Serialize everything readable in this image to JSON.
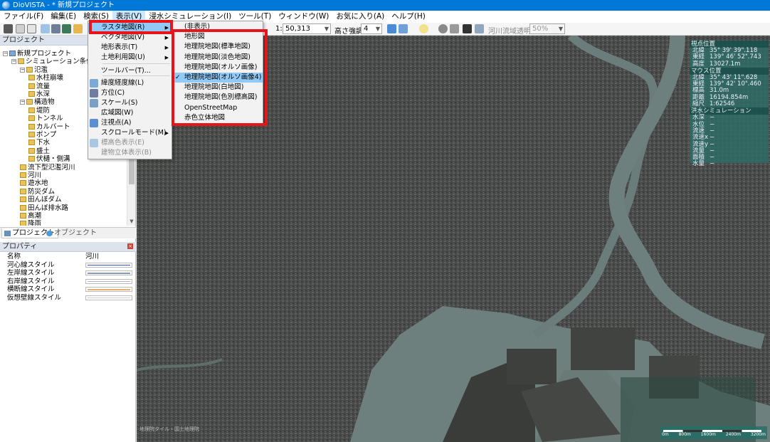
{
  "window": {
    "title": "DioVISTA - * 新規プロジェクト"
  },
  "menubar": [
    "ファイル(F)",
    "編集(E)",
    "検索(S)",
    "表示(V)",
    "浸水シミュレーション(I)",
    "ツール(T)",
    "ウィンドウ(W)",
    "お気に入り(A)",
    "ヘルプ(H)"
  ],
  "toolbar": {
    "scale_prefix": "1:",
    "scale_value": "50,313",
    "exaggeration_label": "高さ強調:",
    "exaggeration_value": "4",
    "transparency_label": "河川流域透明度:",
    "transparency_value": "50%"
  },
  "project_panel": {
    "title": "プロジェクト",
    "tree": [
      {
        "label": "新規プロジェクト",
        "depth": 0,
        "box": "−"
      },
      {
        "label": "シミュレーション条件",
        "depth": 1,
        "box": "−"
      },
      {
        "label": "氾濫",
        "depth": 2,
        "box": "−"
      },
      {
        "label": "水柱崩壊",
        "depth": 3,
        "box": ""
      },
      {
        "label": "流量",
        "depth": 3,
        "box": ""
      },
      {
        "label": "水深",
        "depth": 3,
        "box": ""
      },
      {
        "label": "構造物",
        "depth": 2,
        "box": "−"
      },
      {
        "label": "堤防",
        "depth": 3,
        "box": ""
      },
      {
        "label": "トンネル",
        "depth": 3,
        "box": ""
      },
      {
        "label": "カルバート",
        "depth": 3,
        "box": ""
      },
      {
        "label": "ポンプ",
        "depth": 3,
        "box": ""
      },
      {
        "label": "下水",
        "depth": 3,
        "box": ""
      },
      {
        "label": "盛土",
        "depth": 3,
        "box": ""
      },
      {
        "label": "伏樋・側溝",
        "depth": 3,
        "box": ""
      },
      {
        "label": "流下型氾濫河川",
        "depth": 2,
        "box": ""
      },
      {
        "label": "河川",
        "depth": 2,
        "box": ""
      },
      {
        "label": "遊水地",
        "depth": 2,
        "box": ""
      },
      {
        "label": "防災ダム",
        "depth": 2,
        "box": ""
      },
      {
        "label": "田んぼダム",
        "depth": 2,
        "box": ""
      },
      {
        "label": "田んぼ排水路",
        "depth": 2,
        "box": ""
      },
      {
        "label": "高潮",
        "depth": 2,
        "box": ""
      },
      {
        "label": "降雨",
        "depth": 2,
        "box": ""
      }
    ],
    "tabs": [
      "プロジェクト",
      "オブジェクト"
    ]
  },
  "properties": {
    "title": "プロパティ",
    "rows": [
      {
        "key": "名称",
        "value": "河川"
      },
      {
        "key": "河心線スタイル",
        "value": "",
        "line": "#3355cc"
      },
      {
        "key": "左岸線スタイル",
        "value": "",
        "line": "#8899bb"
      },
      {
        "key": "右岸線スタイル",
        "value": "",
        "line": "#aab4cc"
      },
      {
        "key": "横断線スタイル",
        "value": "",
        "line": "#e8b070"
      },
      {
        "key": "仮想壁線スタイル",
        "value": "",
        "line": "#cccccc"
      }
    ]
  },
  "view_menu": {
    "items": [
      {
        "label": "ラスタ地図(R)",
        "sub": true,
        "hl": true,
        "icon": ""
      },
      {
        "label": "ベクタ地図(V)",
        "sub": true,
        "icon": ""
      },
      {
        "label": "地形表示(T)",
        "sub": true,
        "icon": ""
      },
      {
        "label": "土地利用図(U)",
        "sub": true,
        "icon": ""
      },
      {
        "label": "ツールバー(T)...",
        "sub": false,
        "icon": ""
      },
      {
        "label": "緯度経度線(L)",
        "sub": false,
        "icon": "#7aaad6"
      },
      {
        "label": "方位(C)",
        "sub": false,
        "icon": "#6d7ea0"
      },
      {
        "label": "スケール(S)",
        "sub": false,
        "icon": "#7aa0c8"
      },
      {
        "label": "広域図(W)",
        "sub": false,
        "icon": ""
      },
      {
        "label": "注視点(A)",
        "sub": false,
        "icon": "#5b8fd1"
      },
      {
        "label": "スクロールモード(M)",
        "sub": true,
        "icon": ""
      },
      {
        "label": "標高色表示(E)",
        "sub": false,
        "dis": true,
        "icon": "#a9c7e3"
      },
      {
        "label": "建物立体表示(B)",
        "sub": false,
        "dis": true,
        "icon": ""
      }
    ]
  },
  "raster_submenu": {
    "items": [
      {
        "label": "(非表示)"
      },
      {
        "label": "地形図"
      },
      {
        "label": "地理院地図(標準地図)"
      },
      {
        "label": "地理院地図(淡色地図)"
      },
      {
        "label": "地理院地図(オルソ画像)"
      },
      {
        "label": "地理院地図(オルソ画像4)",
        "checked": true
      },
      {
        "label": "地理院地図(白地図)"
      },
      {
        "label": "地理院地図(色別標高図)"
      },
      {
        "label": "OpenStreetMap"
      },
      {
        "label": "赤色立体地図"
      }
    ],
    "check_mark": "✓"
  },
  "info_panel": {
    "viewpoint_title": "視点位置",
    "viewpoint": [
      {
        "k": "北緯",
        "v": "35° 39' 39\".118"
      },
      {
        "k": "東経",
        "v": "139° 46' 52\".743"
      },
      {
        "k": "高度",
        "v": "13027.1m"
      }
    ],
    "mouse_title": "マウス位置",
    "mouse": [
      {
        "k": "北緯",
        "v": "35° 43' 11\".628"
      },
      {
        "k": "東経",
        "v": "139° 42' 10\".460"
      },
      {
        "k": "標高",
        "v": "31.0m"
      },
      {
        "k": "距離",
        "v": "16194.854m"
      },
      {
        "k": "縮尺",
        "v": "1:62546"
      }
    ],
    "flood_title": "洪水シミュレーション",
    "flood": [
      {
        "k": "水深",
        "v": "−"
      },
      {
        "k": "水位",
        "v": "−"
      },
      {
        "k": "流速",
        "v": "−"
      },
      {
        "k": "流速x",
        "v": "−"
      },
      {
        "k": "流速y",
        "v": "−"
      },
      {
        "k": "流量",
        "v": "−"
      },
      {
        "k": "面積",
        "v": "−"
      },
      {
        "k": "水量",
        "v": "−"
      }
    ]
  },
  "scale_labels": [
    "0m",
    "800m",
    "1600m",
    "2400m",
    "3200m"
  ],
  "map_credit": "地理院タイル・国土地理院"
}
